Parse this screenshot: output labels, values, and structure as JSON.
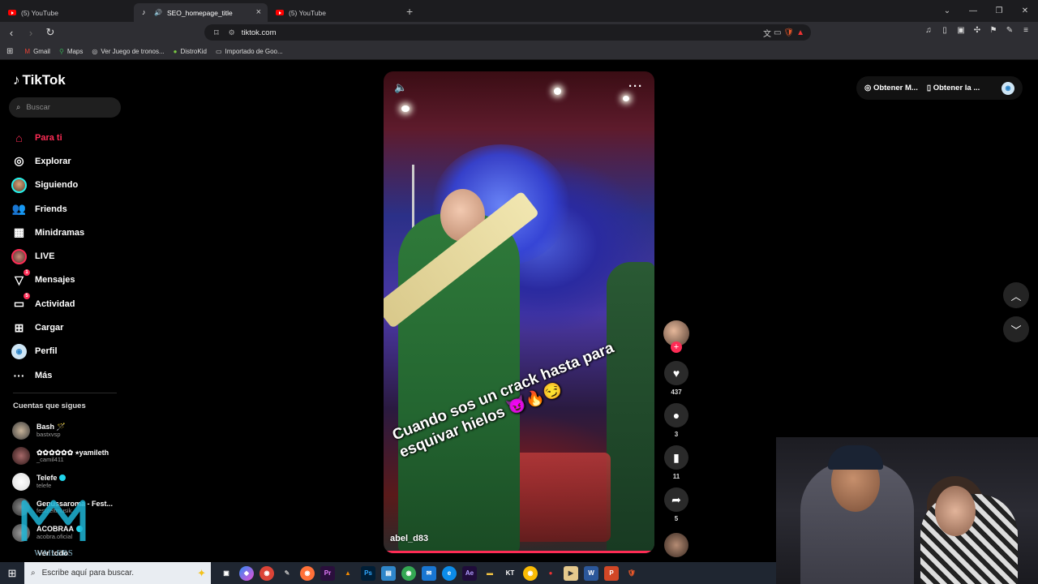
{
  "browser": {
    "tabs": [
      {
        "title": "(5) YouTube",
        "active": false
      },
      {
        "title": "SEO_homepage_title",
        "active": true
      },
      {
        "title": "(5) YouTube",
        "active": false
      }
    ],
    "url": "tiktok.com",
    "bookmarks": [
      "Gmail",
      "Maps",
      "Ver Juego de tronos...",
      "DistroKid",
      "Importado de Goo..."
    ]
  },
  "tiktok": {
    "logo": "TikTok",
    "search_placeholder": "Buscar",
    "nav": [
      {
        "label": "Para ti",
        "icon": "home-icon"
      },
      {
        "label": "Explorar",
        "icon": "compass-icon"
      },
      {
        "label": "Siguiendo",
        "icon": "avatar-icon"
      },
      {
        "label": "Friends",
        "icon": "friends-icon"
      },
      {
        "label": "Minidramas",
        "icon": "film-icon"
      },
      {
        "label": "LIVE",
        "icon": "live-icon"
      },
      {
        "label": "Mensajes",
        "icon": "send-icon",
        "badge": "1"
      },
      {
        "label": "Actividad",
        "icon": "message-icon",
        "badge": "5"
      },
      {
        "label": "Cargar",
        "icon": "plus-square-icon"
      },
      {
        "label": "Perfil",
        "icon": "profile-icon"
      },
      {
        "label": "Más",
        "icon": "more-icon"
      }
    ],
    "following_title": "Cuentas que sigues",
    "following": [
      {
        "name": "Bash 🪄",
        "user": "bastxvsp"
      },
      {
        "name": "✿✿✿✿✿✿ ⭑yamileth",
        "user": "_camil411"
      },
      {
        "name": "Telefe",
        "user": "telefe",
        "verified": true
      },
      {
        "name": "Genussaroma - Fest...",
        "user": "festzeltmusik"
      },
      {
        "name": "ACOBRAA",
        "user": "acobra.oficial",
        "verified": true
      }
    ],
    "see_all": "Ver todo",
    "video": {
      "caption": "Cuando sos un crack hasta para esquivar hielos 😈🔥😏",
      "username": "abel_d83",
      "progress": 0.99
    },
    "actions": {
      "likes": "437",
      "comments": "3",
      "saves": "11",
      "shares": "5"
    },
    "top_right": {
      "btn1": "Obtener M...",
      "btn2": "Obtener la ..."
    }
  },
  "taskbar": {
    "search_placeholder": "Escribe aquí para buscar."
  },
  "watermark": "WAILERS"
}
